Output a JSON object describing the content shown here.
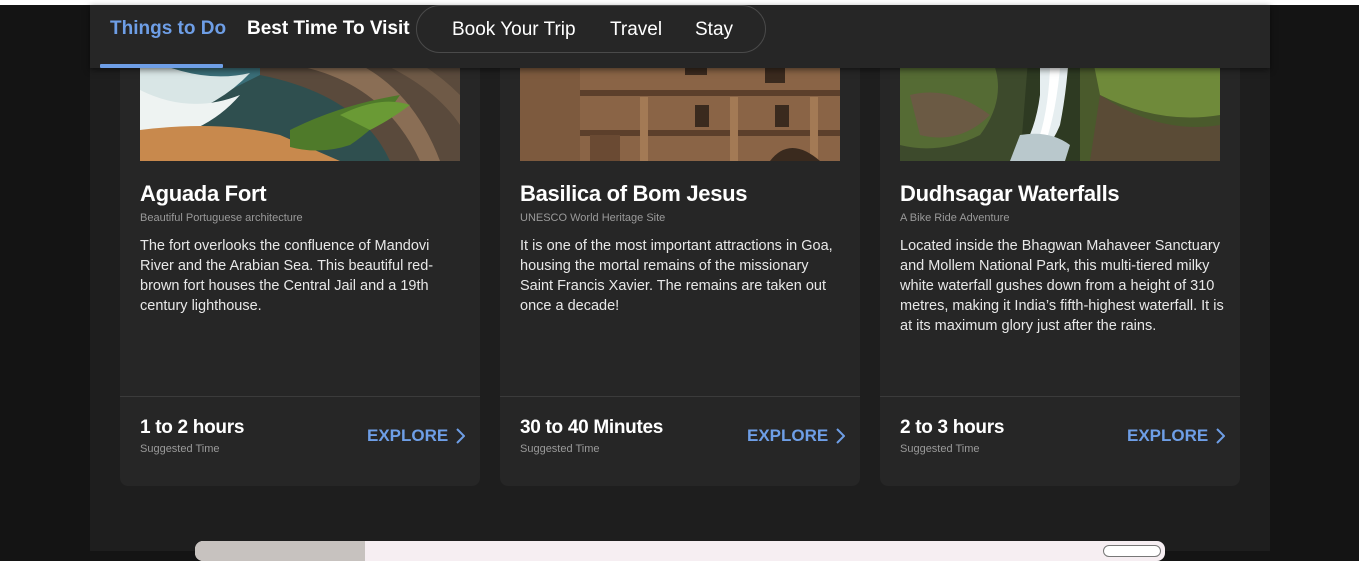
{
  "nav": {
    "tabs": [
      {
        "label": "Things to Do",
        "active": true
      },
      {
        "label": "Best Time To Visit",
        "active": false
      }
    ],
    "pill_tabs": [
      {
        "label": "Book Your Trip"
      },
      {
        "label": "Travel"
      },
      {
        "label": "Stay"
      }
    ],
    "accent_color": "#6e9ee6"
  },
  "cards": [
    {
      "title": "Aguada Fort",
      "subtitle": "Beautiful Portuguese architecture",
      "description": "The fort overlooks the confluence of Mandovi River and the Arabian Sea. This beautiful red-brown fort houses the Central Jail and a 19th century lighthouse.",
      "time": "1 to 2 hours",
      "time_label": "Suggested Time",
      "explore_label": "EXPLORE",
      "icon": "chevron-right-icon"
    },
    {
      "title": "Basilica of Bom Jesus",
      "subtitle": "UNESCO World Heritage Site",
      "description": "It is one of the most important attractions in Goa, housing the mortal remains of the missionary Saint Francis Xavier. The remains are taken out once a decade!",
      "time": "30 to 40 Minutes",
      "time_label": "Suggested Time",
      "explore_label": "EXPLORE",
      "icon": "chevron-right-icon"
    },
    {
      "title": "Dudhsagar Waterfalls",
      "subtitle": "A Bike Ride Adventure",
      "description": "Located inside the Bhagwan Mahaveer Sanctuary and Mollem National Park, this multi-tiered milky white waterfall gushes down from a height of 310 metres, making it India’s fifth-highest waterfall. It is at its maximum glory just after the rains.",
      "time": "2 to 3 hours",
      "time_label": "Suggested Time",
      "explore_label": "EXPLORE",
      "icon": "chevron-right-icon"
    }
  ]
}
